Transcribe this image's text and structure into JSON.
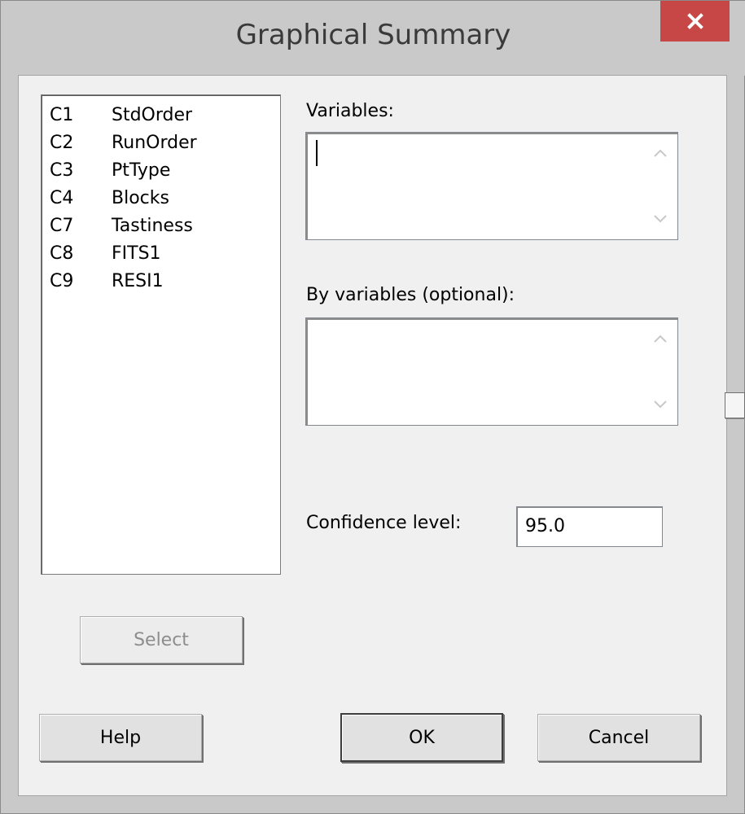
{
  "window": {
    "title": "Graphical Summary",
    "close_icon": "close-icon"
  },
  "variables_list": {
    "items": [
      {
        "col": "C1",
        "name": "StdOrder"
      },
      {
        "col": "C2",
        "name": "RunOrder"
      },
      {
        "col": "C3",
        "name": "PtType"
      },
      {
        "col": "C4",
        "name": "Blocks"
      },
      {
        "col": "C7",
        "name": "Tastiness"
      },
      {
        "col": "C8",
        "name": "FITS1"
      },
      {
        "col": "C9",
        "name": "RESI1"
      }
    ]
  },
  "fields": {
    "variables_label": "Variables:",
    "variables_value": "",
    "by_variables_label": "By variables (optional):",
    "by_variables_value": "",
    "confidence_label": "Confidence level:",
    "confidence_value": "95.0"
  },
  "buttons": {
    "select": "Select",
    "help": "Help",
    "ok": "OK",
    "cancel": "Cancel"
  },
  "colors": {
    "close_button": "#c74747",
    "frame": "#c9c9c9",
    "client": "#f0f0f0"
  }
}
